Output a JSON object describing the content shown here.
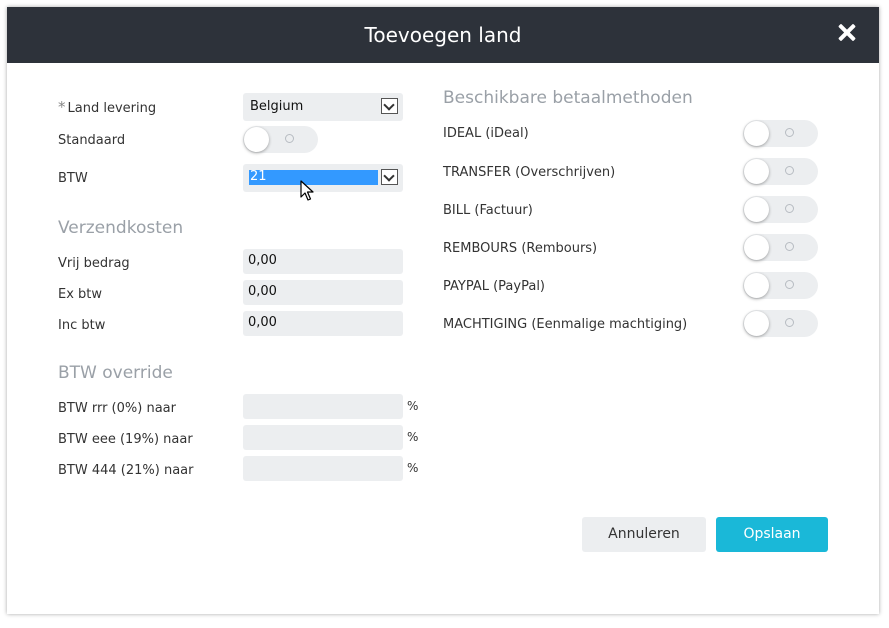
{
  "dialog": {
    "title": "Toevoegen land",
    "close_icon": "close-icon"
  },
  "form": {
    "required_marker": "*",
    "country_label": "Land levering",
    "country_value": "Belgium",
    "standard_label": "Standaard",
    "standard_on": false,
    "vat_label": "BTW",
    "vat_value": "21"
  },
  "shipping": {
    "heading": "Verzendkosten",
    "free_amount_label": "Vrij bedrag",
    "free_amount_value": "0,00",
    "ex_vat_label": "Ex btw",
    "ex_vat_value": "0,00",
    "inc_vat_label": "Inc btw",
    "inc_vat_value": "0,00"
  },
  "vat_override": {
    "heading": "BTW override",
    "rows": [
      {
        "label": "BTW rrr (0%) naar",
        "value": "",
        "unit": "%"
      },
      {
        "label": "BTW eee (19%) naar",
        "value": "",
        "unit": "%"
      },
      {
        "label": "BTW 444 (21%) naar",
        "value": "",
        "unit": "%"
      }
    ]
  },
  "payment_methods": {
    "heading": "Beschikbare betaalmethoden",
    "items": [
      {
        "label": "IDEAL (iDeal)",
        "enabled": false
      },
      {
        "label": "TRANSFER (Overschrijven)",
        "enabled": false
      },
      {
        "label": "BILL (Factuur)",
        "enabled": false
      },
      {
        "label": "REMBOURS (Rembours)",
        "enabled": false
      },
      {
        "label": "PAYPAL (PayPal)",
        "enabled": false
      },
      {
        "label": "MACHTIGING (Eenmalige machtiging)",
        "enabled": false
      }
    ]
  },
  "actions": {
    "cancel_label": "Annuleren",
    "save_label": "Opslaan"
  },
  "colors": {
    "titlebar": "#2d323a",
    "accent": "#1ab8d8",
    "selection": "#3399ff",
    "field_bg": "#eceef0"
  }
}
